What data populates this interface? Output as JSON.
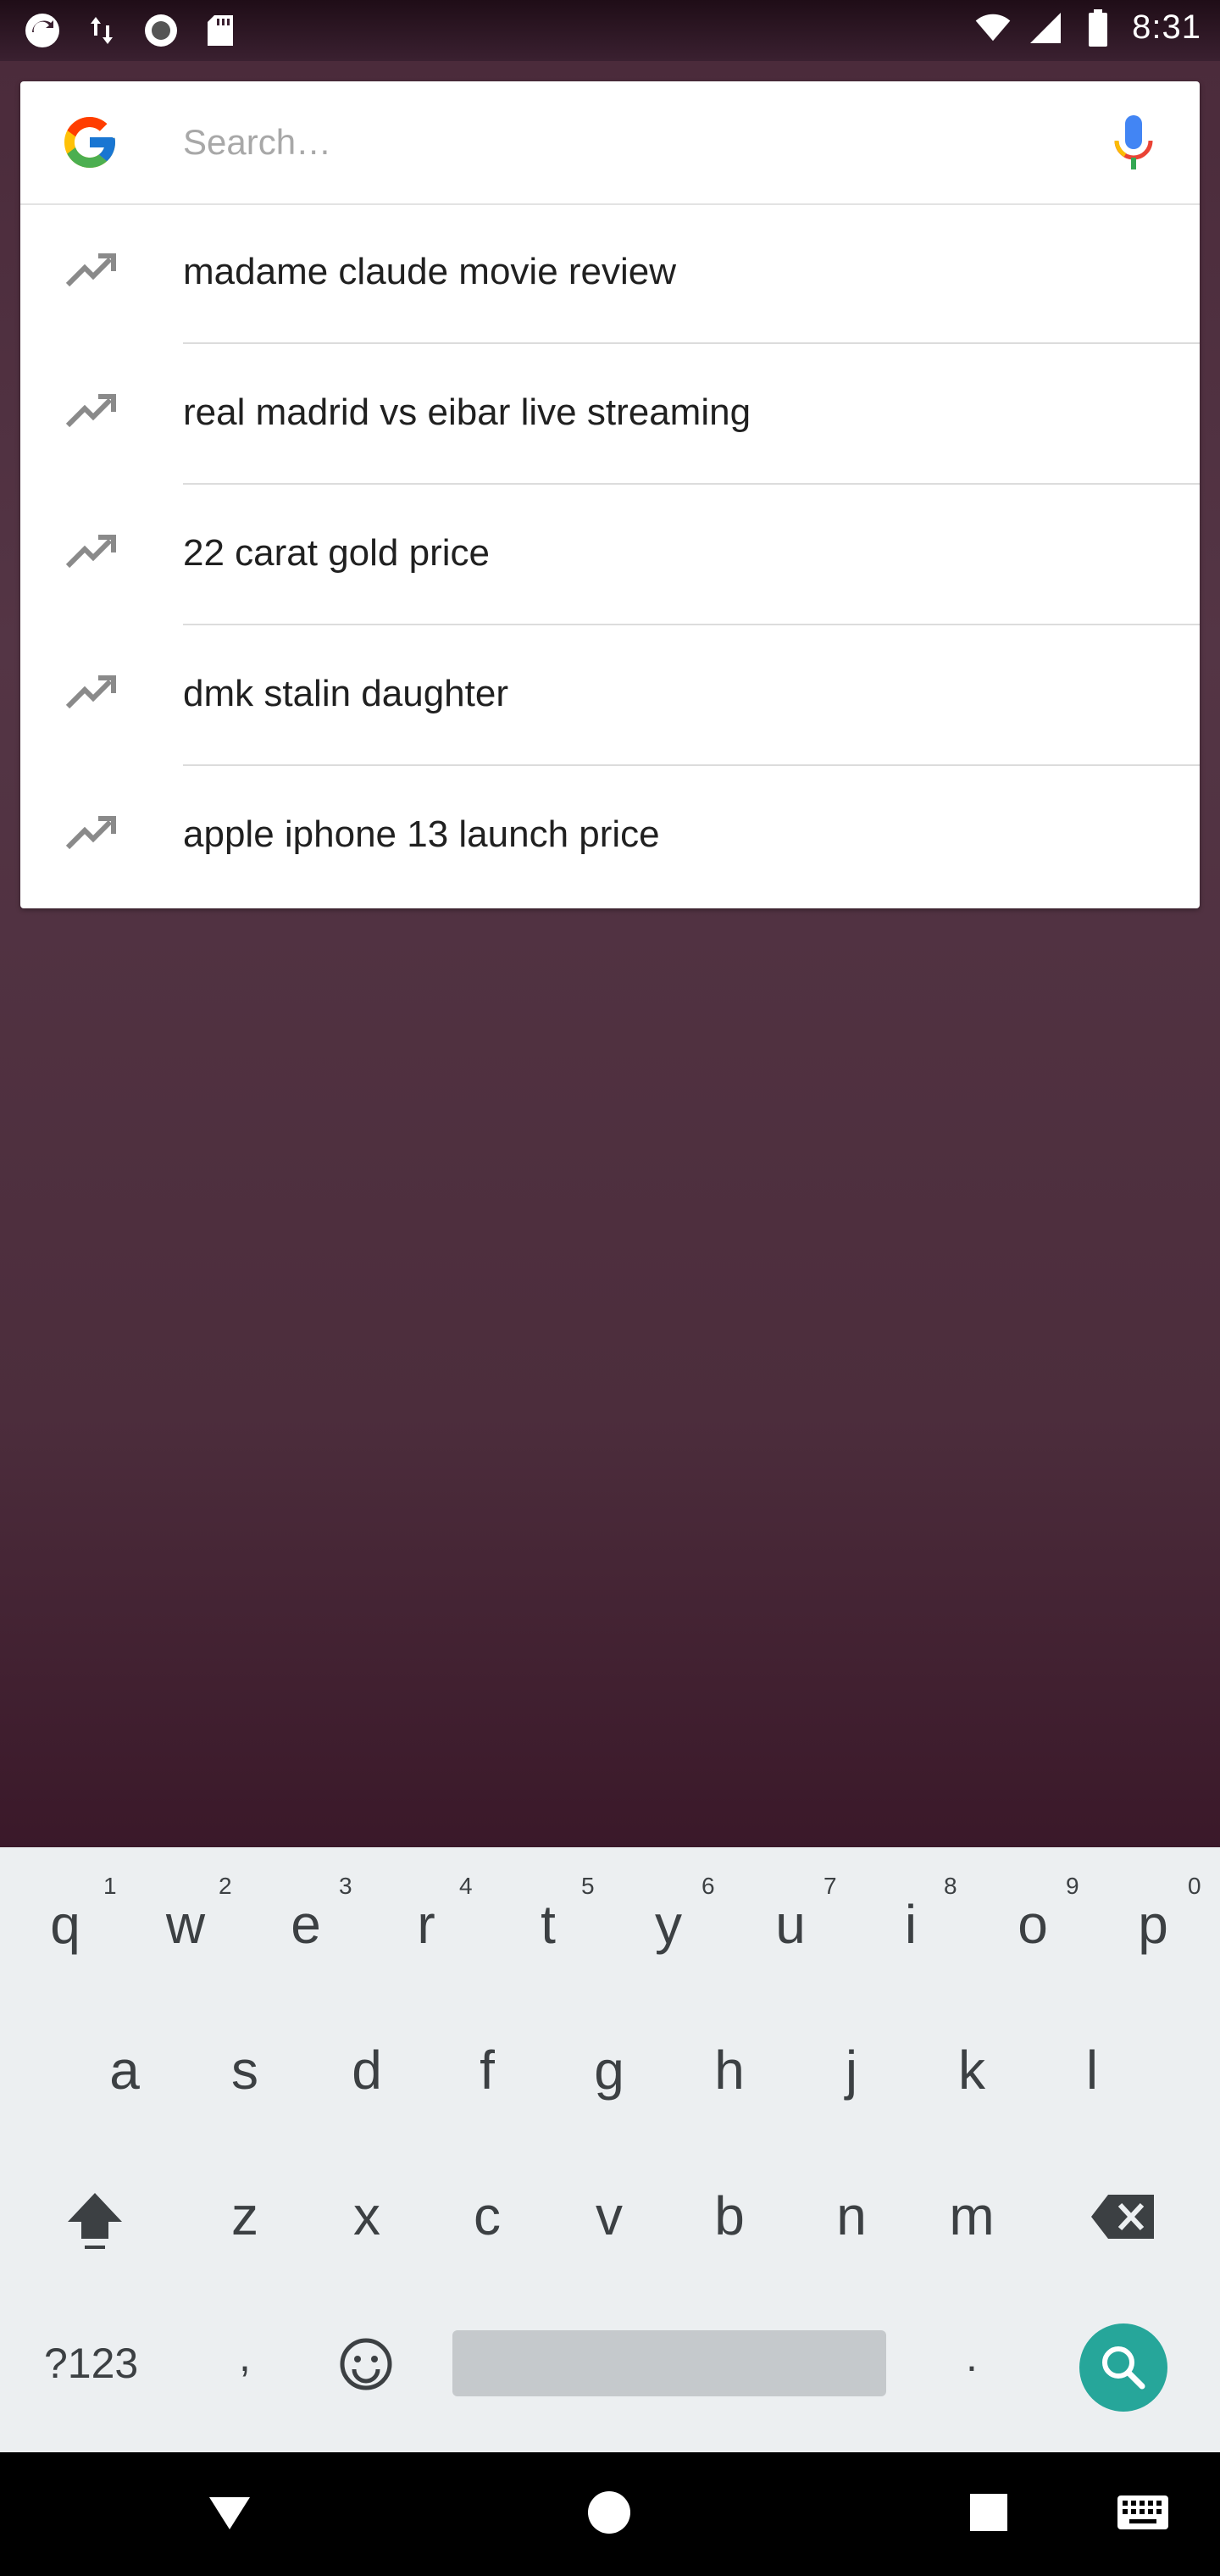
{
  "status_bar": {
    "time": "8:31",
    "left_icons": [
      "sync-icon",
      "data-transfer-icon",
      "record-icon",
      "sd-card-icon"
    ],
    "right_icons": [
      "wifi-icon",
      "cell-signal-icon",
      "battery-icon"
    ]
  },
  "search": {
    "placeholder": "Search…",
    "value": ""
  },
  "suggestions": [
    {
      "text": "madame claude movie review",
      "icon": "trending-icon"
    },
    {
      "text": "real madrid vs eibar live streaming",
      "icon": "trending-icon"
    },
    {
      "text": "22 carat gold price",
      "icon": "trending-icon"
    },
    {
      "text": "dmk stalin daughter",
      "icon": "trending-icon"
    },
    {
      "text": "apple iphone 13 launch price",
      "icon": "trending-icon"
    }
  ],
  "keyboard": {
    "row1": [
      "q",
      "w",
      "e",
      "r",
      "t",
      "y",
      "u",
      "i",
      "o",
      "p"
    ],
    "row1_hints": [
      "1",
      "2",
      "3",
      "4",
      "5",
      "6",
      "7",
      "8",
      "9",
      "0"
    ],
    "row2": [
      "a",
      "s",
      "d",
      "f",
      "g",
      "h",
      "j",
      "k",
      "l"
    ],
    "row3": [
      "z",
      "x",
      "c",
      "v",
      "b",
      "n",
      "m"
    ],
    "symbols_label": "?123",
    "comma": ",",
    "period": "."
  },
  "colors": {
    "accent_teal": "#26a69a",
    "card_bg": "#ffffff",
    "keyboard_bg": "#eceff1"
  }
}
